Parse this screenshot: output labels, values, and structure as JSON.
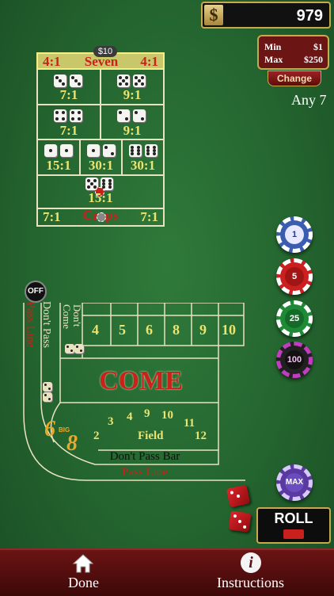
{
  "balance": {
    "symbol": "$",
    "amount": "979"
  },
  "limits": {
    "min_label": "Min",
    "min_value": "$1",
    "max_label": "Max",
    "max_value": "$250",
    "change_label": "Change"
  },
  "current_bet_label": "Any 7",
  "props": {
    "seven": {
      "left_odds": "4:1",
      "label": "Seven",
      "right_odds": "4:1",
      "chip_amount": "$10"
    },
    "hard6": "7:1",
    "hard10": "9:1",
    "hard8": "7:1",
    "hard4": "9:1",
    "aces": "15:1",
    "ace_deuce": "30:1",
    "twelve": "30:1",
    "eleven": "15:1",
    "craps": {
      "left_odds": "7:1",
      "label": "Craps",
      "right_odds": "7:1"
    }
  },
  "chips": [
    {
      "name": "chip-1",
      "label": "1",
      "color": "#3b5db0"
    },
    {
      "name": "chip-5",
      "label": "5",
      "color": "#cc2020"
    },
    {
      "name": "chip-25",
      "label": "25",
      "color": "#1f8a36"
    },
    {
      "name": "chip-100",
      "label": "100",
      "color": "#202020"
    }
  ],
  "max_chip_label": "MAX",
  "puck_label": "OFF",
  "table": {
    "pass_line_side": "Pass Line",
    "dont_pass_side": "Don't Pass",
    "dont_come": "Don't Come",
    "numbers": [
      "4",
      "5",
      "6",
      "8",
      "9",
      "10"
    ],
    "come": "COME",
    "field_numbers": [
      "2",
      "3",
      "4",
      "9",
      "10",
      "11",
      "12"
    ],
    "field": "Field",
    "big6": "6",
    "big8": "8",
    "big_label": "BIG",
    "dont_pass_bar": "Don't Pass Bar",
    "pass_line": "Pass Line"
  },
  "roll_label": "ROLL",
  "nav": {
    "done": "Done",
    "instructions": "Instructions"
  },
  "colors": {
    "felt": "#24652f",
    "odds_yellow": "#ede36d",
    "bar_red": "#6b1414",
    "gold": "#c9a94d"
  }
}
